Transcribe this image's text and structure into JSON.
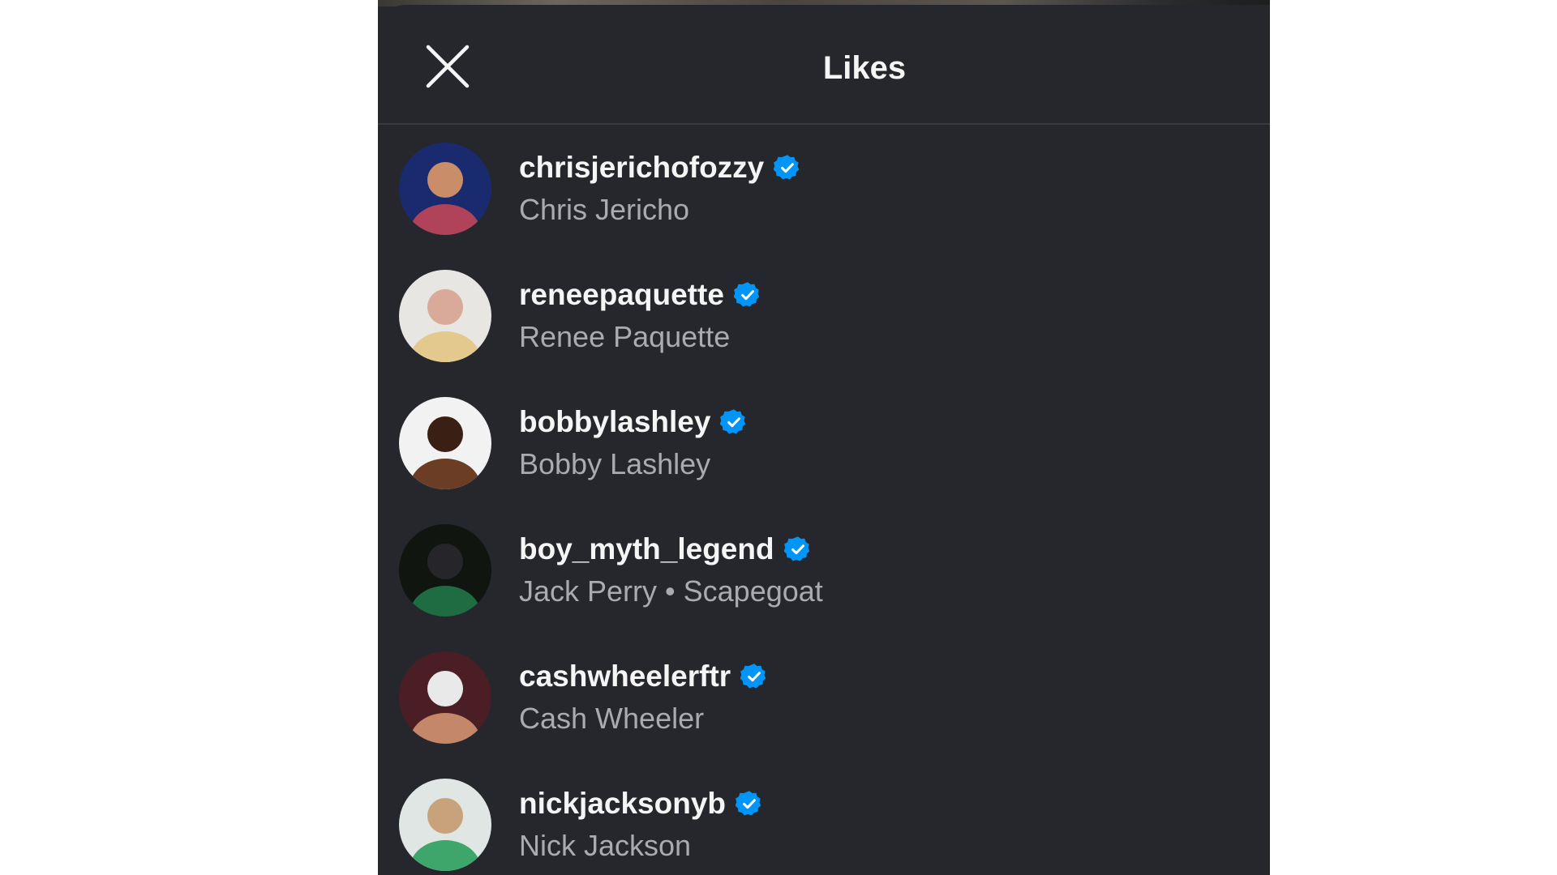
{
  "header": {
    "title": "Likes",
    "close_icon": "close-icon"
  },
  "likes": [
    {
      "username": "chrisjerichofozzy",
      "full_name": "Chris Jericho",
      "verified": true,
      "avatar_colors": [
        "#1a2a6e",
        "#b0435a",
        "#c98d6a"
      ]
    },
    {
      "username": "reneepaquette",
      "full_name": "Renee Paquette",
      "verified": true,
      "avatar_colors": [
        "#e8e6e3",
        "#e4c98e",
        "#d9a99a"
      ]
    },
    {
      "username": "bobbylashley",
      "full_name": "Bobby Lashley",
      "verified": true,
      "avatar_colors": [
        "#f2f2f2",
        "#6b3d25",
        "#3a2014"
      ]
    },
    {
      "username": "boy_myth_legend",
      "full_name": "Jack Perry • Scapegoat",
      "verified": true,
      "avatar_colors": [
        "#101510",
        "#1f6b42",
        "#26262a"
      ]
    },
    {
      "username": "cashwheelerftr",
      "full_name": "Cash Wheeler",
      "verified": true,
      "avatar_colors": [
        "#4a1e24",
        "#c4876a",
        "#e9e9e9"
      ]
    },
    {
      "username": "nickjacksonyb",
      "full_name": "Nick Jackson",
      "verified": true,
      "avatar_colors": [
        "#dfe6e4",
        "#3fa66b",
        "#c8a27a"
      ]
    }
  ],
  "colors": {
    "background": "#25272c",
    "text_primary": "#f5f5f5",
    "text_secondary": "#a9abb0",
    "verified_badge": "#0095f6",
    "divider": "#393b41"
  }
}
